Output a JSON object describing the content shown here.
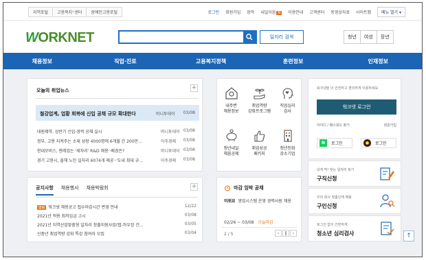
{
  "topbar": {
    "left_links": [
      "지역포털",
      "고용복지⁺센터",
      "장애인고용포털"
    ],
    "right_links": [
      "로그인",
      "회원가입",
      "장학",
      "내일이음",
      "이용안내",
      "고객센터",
      "동영상자료",
      "사이트맵"
    ],
    "badge": "N",
    "all_menu": "메뉴 열기"
  },
  "header": {
    "logo_w": "W",
    "logo_rest": "ORKNET",
    "search_placeholder": "",
    "job_search_label": "일자리 검색",
    "targets": [
      "청년",
      "여성",
      "장년"
    ]
  },
  "gnb": [
    "채용정보",
    "직업·진로",
    "고용복지정책",
    "훈련정보",
    "인재정보"
  ],
  "news": {
    "title": "오늘의 취업뉴스",
    "highlight": {
      "title": "철강업계, 업황 회복에 신입 공채 규모 확대한다",
      "source": "머니투데이",
      "date": "03/08"
    },
    "items": [
      {
        "title": "대원제약, 상반기 신입·경력 공채 실시",
        "source": "머니투데이",
        "date": "03/08"
      },
      {
        "title": "정부, 고용 지켜주는 소재 성장 4000명에 6개월 간 200만원씩",
        "source": "아주경제",
        "date": "03/08"
      },
      {
        "title": "현대모비스, 젠레업는 '세자리' R&D 채용··배경은?",
        "source": "머니투데이",
        "date": "03/08"
      },
      {
        "title": "경기 고용시, 올해 노인 일자리 6074개 제공··'도내 최대 규모'",
        "source": "아주경제",
        "date": "03/08"
      }
    ]
  },
  "services": [
    {
      "label": "내주변\n채용정보",
      "icon": "house-pin-icon"
    },
    {
      "label": "취업역량\n강화프로그램",
      "icon": "sprout-hand-icon"
    },
    {
      "label": "직업심리\n검사",
      "icon": "head-heart-icon"
    },
    {
      "label": "청년내일\n채움공제",
      "icon": "piggy-bank-icon"
    },
    {
      "label": "취업성공\n패키지",
      "icon": "thumbs-up-icon"
    },
    {
      "label": "청년친화\n강소기업",
      "icon": "building-icon"
    }
  ],
  "notice": {
    "tabs": [
      "공지사항",
      "채용행사",
      "채용박람회"
    ],
    "items": [
      {
        "tag": "알림",
        "title": "워크넷 채용공고 접수마감시간 변경 안내",
        "date": "12/22"
      },
      {
        "tag": "",
        "title": "2021년 적용 최저임금 고시",
        "date": "03/08"
      },
      {
        "tag": "",
        "title": "2021년 지역산업맞춤형 일자리 창출지원사업(탭-하우징 건...",
        "date": "03/05"
      },
      {
        "tag": "",
        "title": "신중년 취업역량 강화 특강 참여자 모집",
        "date": "03/04"
      }
    ]
  },
  "deadline": {
    "title": "마감 임박 공채",
    "company": "이위요",
    "desc": "영업시스템 운영 경력사원 채용",
    "period": "02/26 ~ 03/08",
    "today": "오늘마감",
    "page": "2 / 5"
  },
  "login": {
    "message": "워크넷을 더 안전하고 편리하게 이용하세요.",
    "button": "워크넷 로그인",
    "find_link": "아이디 / 패스워드 찾기",
    "join_link": "회원가입",
    "naver": "로그인",
    "kakao": "로그인"
  },
  "promos": [
    {
      "sub": "내게 딱! 맞는 일자리 찾기",
      "main": "구직신청",
      "icon": "document-pen-icon"
    },
    {
      "sub": "우리 회사 맞춤인재 채용",
      "main": "구인신청",
      "icon": "person-search-icon"
    },
    {
      "sub": "로그인 없이 간편하게",
      "main": "청소년 심리검사",
      "icon": "document-check-icon"
    }
  ],
  "colors": {
    "primary": "#1c64b4",
    "accent": "#e8781f",
    "login": "#1f5c73"
  }
}
